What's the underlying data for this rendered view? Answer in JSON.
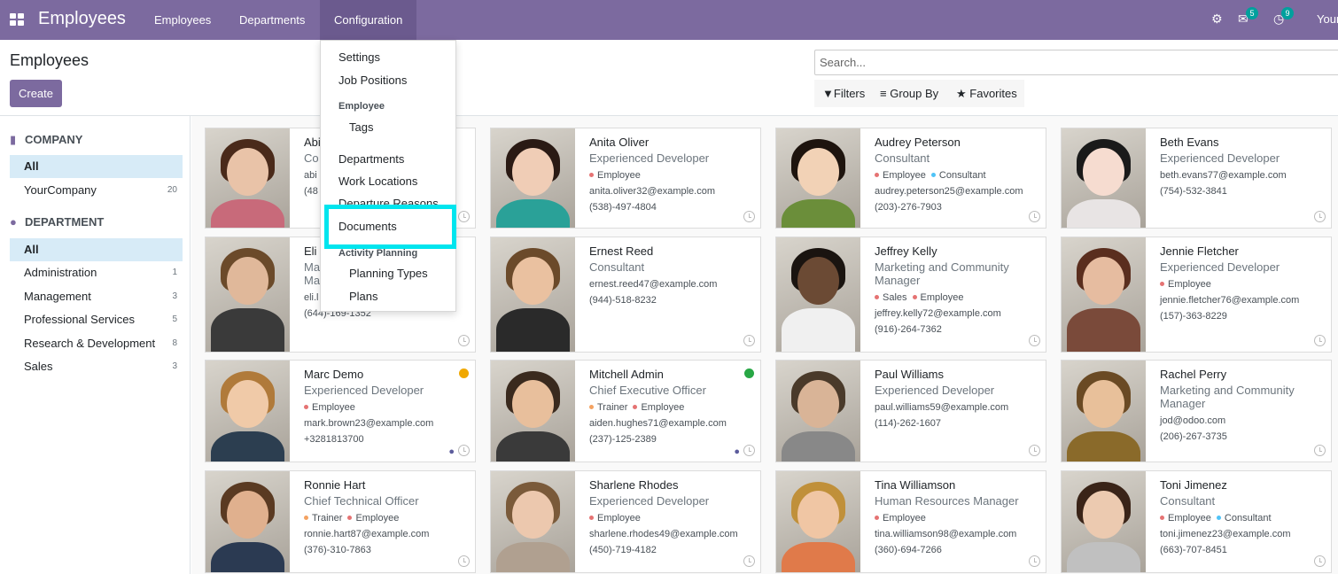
{
  "navbar": {
    "app_title": "Employees",
    "menu": [
      "Employees",
      "Departments",
      "Configuration"
    ],
    "active_menu": "Configuration",
    "messages_badge": "5",
    "activities_badge": "9",
    "user_label": "Your",
    "color": "#7c6a9f"
  },
  "control_panel": {
    "title": "Employees",
    "create_label": "Create",
    "search_placeholder": "Search...",
    "filters_label": "Filters",
    "groupby_label": "Group By",
    "favorites_label": "Favorites"
  },
  "sidebar": {
    "company_heading": "COMPANY",
    "company_items": [
      {
        "label": "All",
        "count": ""
      },
      {
        "label": "YourCompany",
        "count": "20"
      }
    ],
    "department_heading": "DEPARTMENT",
    "department_items": [
      {
        "label": "All",
        "count": ""
      },
      {
        "label": "Administration",
        "count": "1"
      },
      {
        "label": "Management",
        "count": "3"
      },
      {
        "label": "Professional Services",
        "count": "5"
      },
      {
        "label": "Research & Development",
        "count": "8"
      },
      {
        "label": "Sales",
        "count": "3"
      }
    ]
  },
  "config_menu": {
    "settings": "Settings",
    "job_positions": "Job Positions",
    "employee_heading": "Employee",
    "tags": "Tags",
    "departments": "Departments",
    "work_locations": "Work Locations",
    "departure_reasons": "Departure Reasons",
    "documents": "Documents",
    "activity_heading": "Activity Planning",
    "planning_types": "Planning Types",
    "plans": "Plans"
  },
  "employees": [
    {
      "name": "Abi",
      "job": "Co",
      "tags": [],
      "email": "abi",
      "phone": "(48",
      "skin": "#e9c3a8",
      "hair": "#4a2a1a",
      "shirt": "#c86a7a"
    },
    {
      "name": "Anita Oliver",
      "job": "Experienced Developer",
      "tags": [
        {
          "label": "Employee",
          "color": "#e57373"
        }
      ],
      "email": "anita.oliver32@example.com",
      "phone": "(538)-497-4804",
      "skin": "#f0cdb6",
      "hair": "#2a1a14",
      "shirt": "#2aa198"
    },
    {
      "name": "Audrey Peterson",
      "job": "Consultant",
      "tags": [
        {
          "label": "Employee",
          "color": "#e57373"
        },
        {
          "label": "Consultant",
          "color": "#4fc3f7"
        }
      ],
      "email": "audrey.peterson25@example.com",
      "phone": "(203)-276-7903",
      "skin": "#f2d2b6",
      "hair": "#1e140e",
      "shirt": "#6b8e3a"
    },
    {
      "name": "Beth Evans",
      "job": "Experienced Developer",
      "tags": [],
      "email": "beth.evans77@example.com",
      "phone": "(754)-532-3841",
      "skin": "#f6dcd0",
      "hair": "#1a1a1a",
      "shirt": "#e8e4e4"
    },
    {
      "name": "Eli",
      "job": "Ma",
      "job2": "Ma",
      "tags": [],
      "email": "eli.l",
      "phone": "(644)-169-1352",
      "skin": "#e0b89a",
      "hair": "#6b4a2a",
      "shirt": "#3a3a3a"
    },
    {
      "name": "Ernest Reed",
      "job": "Consultant",
      "tags": [],
      "email": "ernest.reed47@example.com",
      "phone": "(944)-518-8232",
      "skin": "#eac1a0",
      "hair": "#6b4a2a",
      "shirt": "#2a2a2a"
    },
    {
      "name": "Jeffrey Kelly",
      "job": "Marketing and Community Manager",
      "tags": [
        {
          "label": "Sales",
          "color": "#e57373"
        },
        {
          "label": "Employee",
          "color": "#e57373"
        }
      ],
      "email": "jeffrey.kelly72@example.com",
      "phone": "(916)-264-7362",
      "skin": "#6b4a34",
      "hair": "#1a1410",
      "shirt": "#f0f0f0"
    },
    {
      "name": "Jennie Fletcher",
      "job": "Experienced Developer",
      "tags": [
        {
          "label": "Employee",
          "color": "#e57373"
        }
      ],
      "email": "jennie.fletcher76@example.com",
      "phone": "(157)-363-8229",
      "skin": "#e6bca0",
      "hair": "#5a2e1e",
      "shirt": "#7a4a3a"
    },
    {
      "name": "Marc Demo",
      "job": "Experienced Developer",
      "tags": [
        {
          "label": "Employee",
          "color": "#e57373"
        }
      ],
      "email": "mark.brown23@example.com",
      "phone": "+3281813700",
      "presence": "#f0a800",
      "chat": true,
      "skin": "#f0caa8",
      "hair": "#b07a3a",
      "shirt": "#2c3e50"
    },
    {
      "name": "Mitchell Admin",
      "job": "Chief Executive Officer",
      "tags": [
        {
          "label": "Trainer",
          "color": "#f4a261"
        },
        {
          "label": "Employee",
          "color": "#e57373"
        }
      ],
      "email": "aiden.hughes71@example.com",
      "phone": "(237)-125-2389",
      "presence": "#28a745",
      "chat": true,
      "skin": "#e8bf9c",
      "hair": "#3a2a1e",
      "shirt": "#3a3a3a"
    },
    {
      "name": "Paul Williams",
      "job": "Experienced Developer",
      "tags": [],
      "email": "paul.williams59@example.com",
      "phone": "(114)-262-1607",
      "skin": "#d9b497",
      "hair": "#4a3a2a",
      "shirt": "#888888"
    },
    {
      "name": "Rachel Perry",
      "job": "Marketing and Community Manager",
      "tags": [],
      "email": "jod@odoo.com",
      "phone": "(206)-267-3735",
      "skin": "#e8c09a",
      "hair": "#6a4a24",
      "shirt": "#8a6a2a"
    },
    {
      "name": "Ronnie Hart",
      "job": "Chief Technical Officer",
      "tags": [
        {
          "label": "Trainer",
          "color": "#f4a261"
        },
        {
          "label": "Employee",
          "color": "#e57373"
        }
      ],
      "email": "ronnie.hart87@example.com",
      "phone": "(376)-310-7863",
      "skin": "#e0b08e",
      "hair": "#5a3a22",
      "shirt": "#2b3a52"
    },
    {
      "name": "Sharlene Rhodes",
      "job": "Experienced Developer",
      "tags": [
        {
          "label": "Employee",
          "color": "#e57373"
        }
      ],
      "email": "sharlene.rhodes49@example.com",
      "phone": "(450)-719-4182",
      "skin": "#ecc8ae",
      "hair": "#7a5a3a",
      "shirt": "#b0a090"
    },
    {
      "name": "Tina Williamson",
      "job": "Human Resources Manager",
      "tags": [
        {
          "label": "Employee",
          "color": "#e57373"
        }
      ],
      "email": "tina.williamson98@example.com",
      "phone": "(360)-694-7266",
      "skin": "#f0c6a4",
      "hair": "#c0903a",
      "shirt": "#e07a4a"
    },
    {
      "name": "Toni Jimenez",
      "job": "Consultant",
      "tags": [
        {
          "label": "Employee",
          "color": "#e57373"
        },
        {
          "label": "Consultant",
          "color": "#4fc3f7"
        }
      ],
      "email": "toni.jimenez23@example.com",
      "phone": "(663)-707-8451",
      "skin": "#eccab0",
      "hair": "#3a2418",
      "shirt": "#c0c0c0"
    }
  ]
}
